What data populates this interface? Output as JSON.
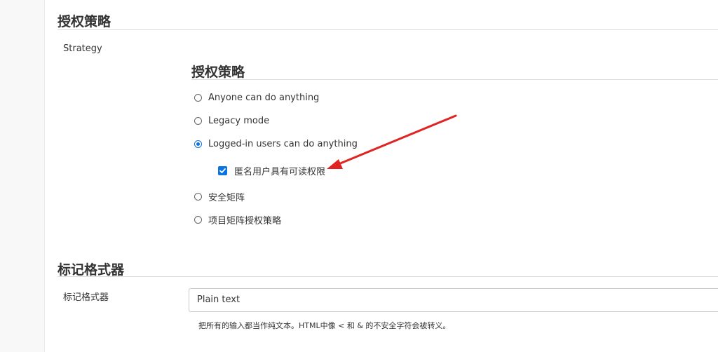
{
  "authorization_section": {
    "title": "授权策略",
    "strategy_label": "Strategy",
    "sub_title": "授权策略",
    "options": [
      {
        "label": "Anyone can do anything",
        "checked": false
      },
      {
        "label": "Legacy mode",
        "checked": false
      },
      {
        "label": "Logged-in users can do anything",
        "checked": true
      },
      {
        "label": "安全矩阵",
        "checked": false
      },
      {
        "label": "项目矩阵授权策略",
        "checked": false
      }
    ],
    "anonymous_read": {
      "label": "匿名用户具有可读权限",
      "checked": true
    }
  },
  "markup_section": {
    "title": "标记格式器",
    "field_label": "标记格式器",
    "field_value": "Plain text",
    "help_text": "把所有的输入都当作纯文本。HTML中像 < 和 & 的不安全字符会被转义。"
  },
  "colors": {
    "accent": "#0b74de",
    "annotation_arrow": "#e02424"
  }
}
